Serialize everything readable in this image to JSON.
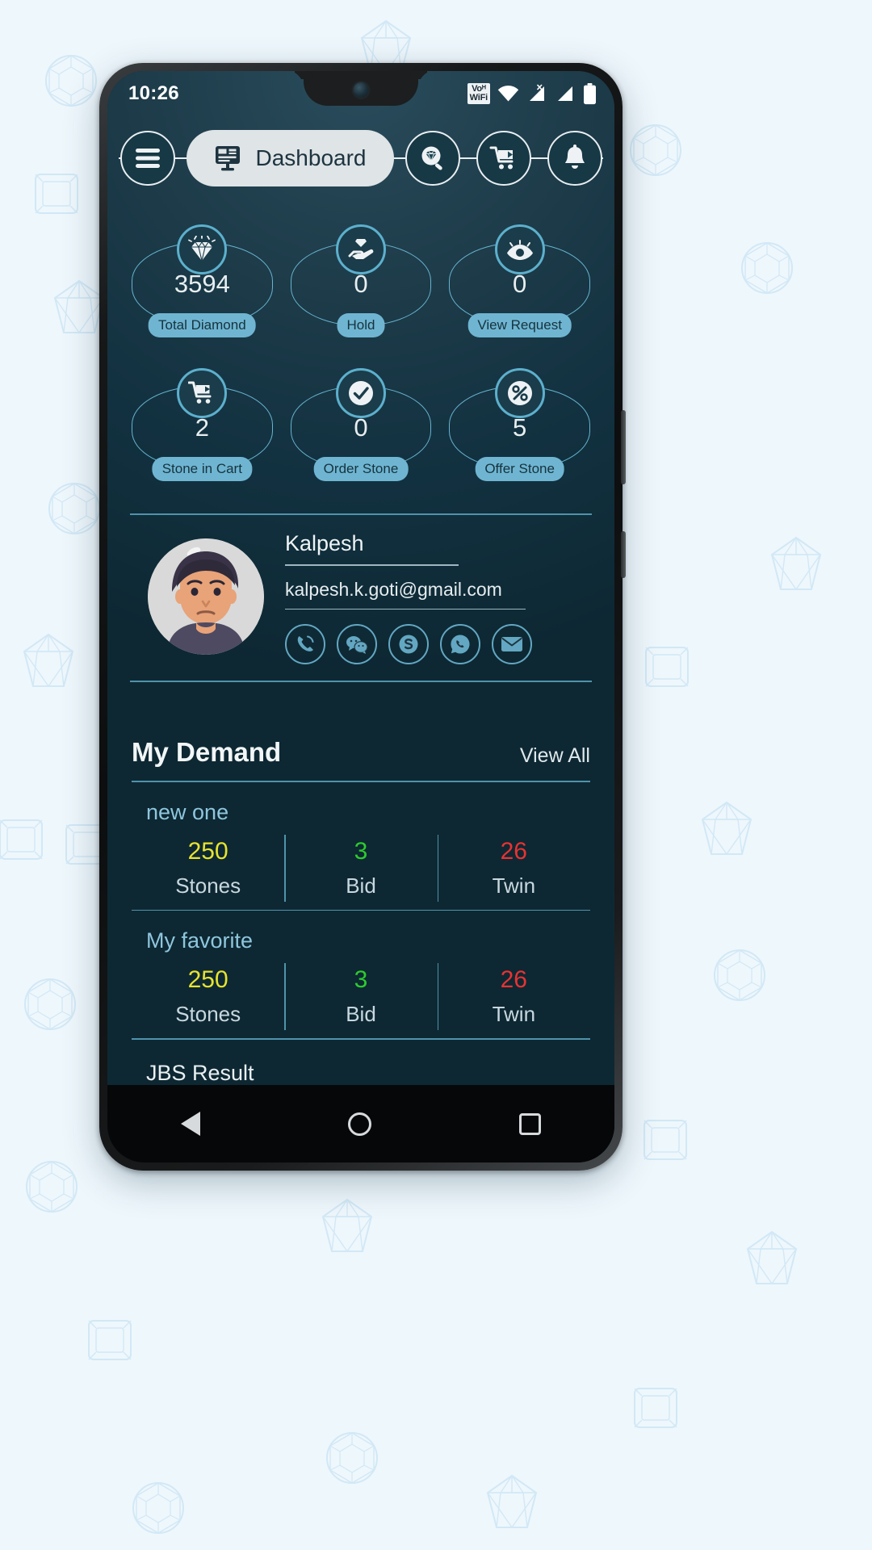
{
  "statusbar": {
    "time": "10:26",
    "vowifi_line1": "Voᴴ",
    "vowifi_line2": "WiFi",
    "icons": [
      "vowifi-icon",
      "wifi-icon",
      "signal-no-sim-icon",
      "signal-icon",
      "battery-icon"
    ]
  },
  "topnav": {
    "menu_icon": "hamburger-menu-icon",
    "active_tab_label": "Dashboard",
    "active_tab_icon": "dashboard-icon",
    "search_icon": "diamond-search-icon",
    "cart_icon": "shopping-cart-icon",
    "bell_icon": "notification-bell-icon"
  },
  "stats": [
    {
      "value": "3594",
      "label": "Total Diamond",
      "icon": "diamond-icon"
    },
    {
      "value": "0",
      "label": "Hold",
      "icon": "hand-diamond-icon"
    },
    {
      "value": "0",
      "label": "View Request",
      "icon": "eye-icon"
    },
    {
      "value": "2",
      "label": "Stone in Cart",
      "icon": "cart-icon"
    },
    {
      "value": "0",
      "label": "Order Stone",
      "icon": "check-circle-icon"
    },
    {
      "value": "5",
      "label": "Offer Stone",
      "icon": "percent-icon"
    }
  ],
  "profile": {
    "avatar": "user-avatar",
    "name": "Kalpesh",
    "email": "kalpesh.k.goti@gmail.com",
    "socials": [
      {
        "name": "phone-call-icon"
      },
      {
        "name": "wechat-icon"
      },
      {
        "name": "skype-icon"
      },
      {
        "name": "whatsapp-icon"
      },
      {
        "name": "email-icon"
      }
    ]
  },
  "demand": {
    "title": "My Demand",
    "view_all": "View All",
    "groups": [
      {
        "name": "new one",
        "stats": [
          {
            "value": "250",
            "label": "Stones",
            "color": "#e8e32e"
          },
          {
            "value": "3",
            "label": "Bid",
            "color": "#2ecb2e"
          },
          {
            "value": "26",
            "label": "Twin",
            "color": "#e83232"
          }
        ]
      },
      {
        "name": "My favorite",
        "stats": [
          {
            "value": "250",
            "label": "Stones",
            "color": "#e8e32e"
          },
          {
            "value": "3",
            "label": "Bid",
            "color": "#2ecb2e"
          },
          {
            "value": "26",
            "label": "Twin",
            "color": "#e83232"
          }
        ]
      }
    ],
    "next_section": "JBS Result"
  },
  "navbar": {
    "back": "back-triangle-icon",
    "home": "home-circle-icon",
    "recents": "recents-square-icon"
  },
  "colors": {
    "accent": "#5cb0cd",
    "pill": "#6fb5d1",
    "screen_dark": "#0d2833",
    "page_bg": "#eef7fc"
  }
}
